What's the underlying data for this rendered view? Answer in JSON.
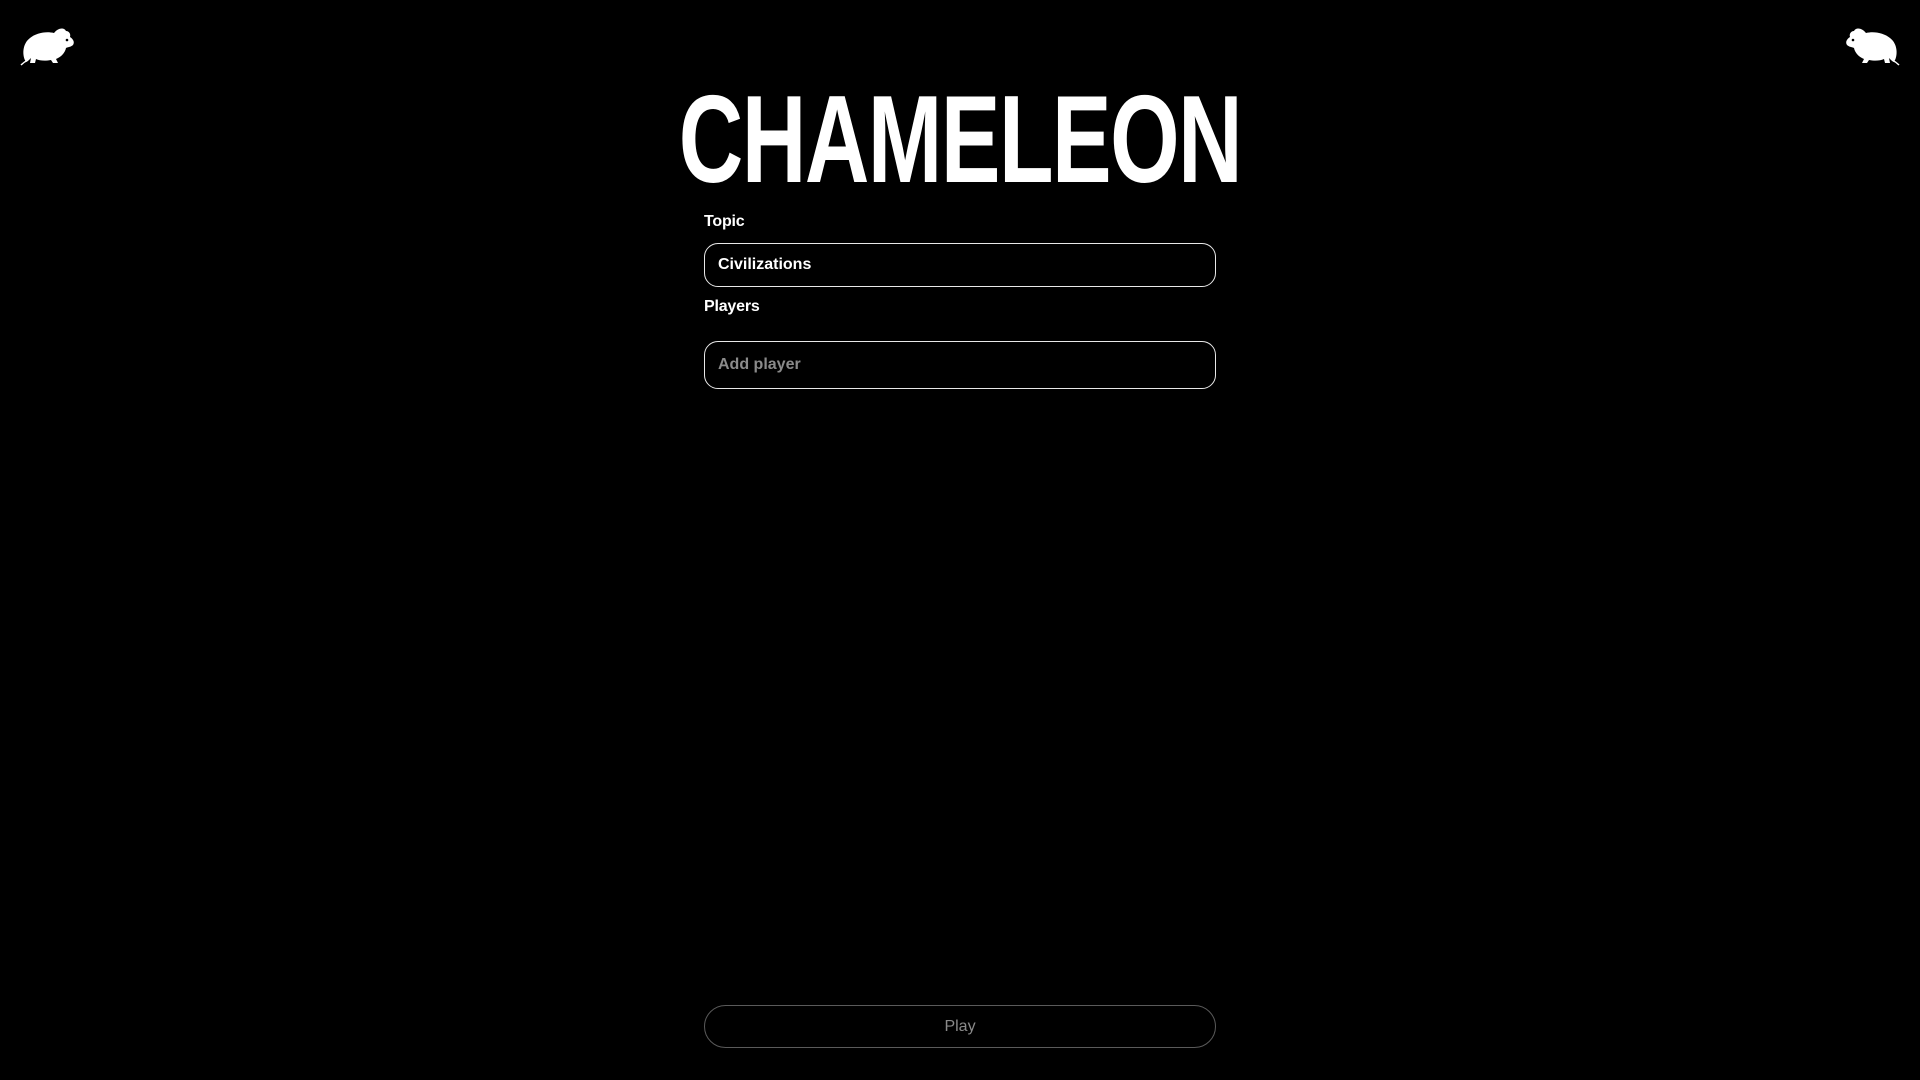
{
  "app": {
    "title": "CHAMELEON"
  },
  "icons": {
    "left": "rat-icon",
    "right": "rat-icon"
  },
  "form": {
    "topic_label": "Topic",
    "topic_value": "Civilizations",
    "players_label": "Players",
    "player_placeholder": "Add player",
    "player_value": ""
  },
  "actions": {
    "play_label": "Play"
  },
  "colors": {
    "background": "#000000",
    "foreground": "#ffffff",
    "placeholder": "#8a8a8a",
    "disabled_border": "#5a5a5a"
  }
}
